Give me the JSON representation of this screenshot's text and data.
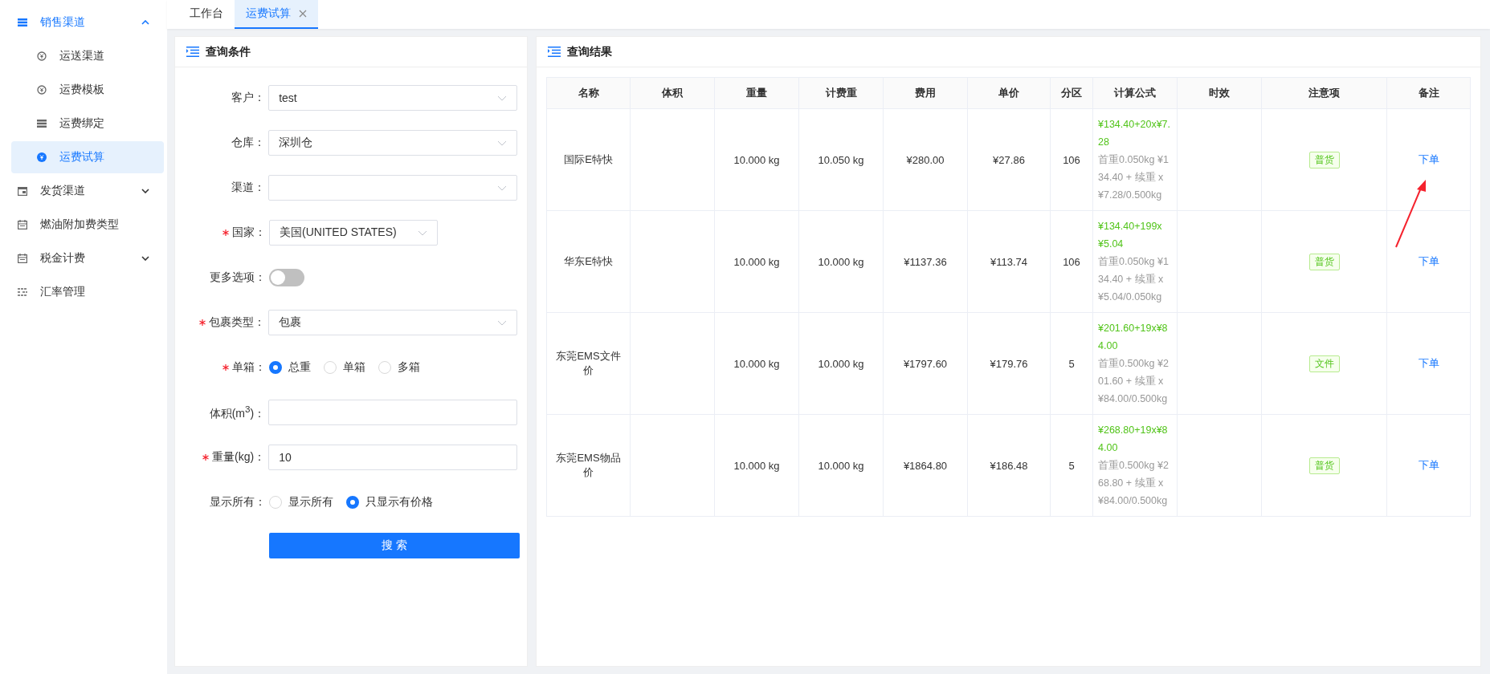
{
  "sidebar": {
    "items": [
      {
        "label": "销售渠道",
        "expanded": true,
        "children": [
          {
            "label": "运送渠道",
            "selected": false
          },
          {
            "label": "运费模板",
            "selected": false
          },
          {
            "label": "运费绑定",
            "selected": false
          },
          {
            "label": "运费试算",
            "selected": true
          }
        ]
      },
      {
        "label": "发货渠道",
        "expanded": false
      },
      {
        "label": "燃油附加费类型"
      },
      {
        "label": "税金计费",
        "expanded": false
      },
      {
        "label": "汇率管理"
      }
    ]
  },
  "tabs": [
    {
      "label": "工作台",
      "selected": false,
      "closable": false
    },
    {
      "label": "运费试算",
      "selected": true,
      "closable": true
    }
  ],
  "query_panel": {
    "title": "查询条件",
    "fields": [
      {
        "kind": "select",
        "label": "客户：",
        "required": false,
        "value": "test"
      },
      {
        "kind": "select",
        "label": "仓库：",
        "required": false,
        "value": "深圳仓"
      },
      {
        "kind": "select",
        "label": "渠道：",
        "required": false
      },
      {
        "kind": "select",
        "label": "国家：",
        "required": true,
        "value": "美国(UNITED STATES)",
        "narrow": true
      },
      {
        "kind": "switch",
        "label": "更多选项：",
        "required": false,
        "on": false
      },
      {
        "kind": "select",
        "label": "包裹类型：",
        "required": true,
        "value": "包裹"
      },
      {
        "kind": "radio",
        "label": "单箱：",
        "required": true,
        "options": [
          {
            "label": "总重",
            "selected": true
          },
          {
            "label": "单箱",
            "selected": false
          },
          {
            "label": "多箱",
            "selected": false
          }
        ]
      },
      {
        "kind": "input",
        "label": "体积(m$^{3}$)：",
        "required": false
      },
      {
        "kind": "input",
        "label": "重量(kg)：",
        "required": true,
        "value": "10"
      },
      {
        "kind": "radio",
        "label": "显示所有：",
        "required": false,
        "options": [
          {
            "label": "显示所有",
            "selected": false
          },
          {
            "label": "只显示有价格",
            "selected": true
          }
        ]
      }
    ],
    "search_button": "搜 索"
  },
  "result_panel": {
    "title": "查询结果",
    "table": {
      "columns": [
        "名称",
        "体积",
        "重量",
        "计费重",
        "费用",
        "单价",
        "分区",
        "计算公式",
        "时效",
        "注意项",
        "备注"
      ],
      "rows": [
        {
          "name": "国际E特快",
          "weight": "10.000 kg",
          "charged_weight": "10.050 kg",
          "fee": "¥280.00",
          "unit_price": "¥27.86",
          "zone": "106",
          "formula": "¥134.40+20x¥7.28",
          "formula_detail": "首重0.050kg ¥134.40 + 续重 x ¥7.28/0.500kg",
          "tag": "普货",
          "action": "下单"
        },
        {
          "name": "华东E特快",
          "weight": "10.000 kg",
          "charged_weight": "10.000 kg",
          "fee": "¥1137.36",
          "unit_price": "¥113.74",
          "zone": "106",
          "formula": "¥134.40+199x¥5.04",
          "formula_detail": "首重0.050kg ¥134.40 + 续重 x ¥5.04/0.050kg",
          "tag": "普货",
          "action": "下单"
        },
        {
          "name": "东莞EMS文件价",
          "weight": "10.000 kg",
          "charged_weight": "10.000 kg",
          "fee": "¥1797.60",
          "unit_price": "¥179.76",
          "zone": "5",
          "formula": "¥201.60+19x¥84.00",
          "formula_detail": "首重0.500kg ¥201.60 + 续重 x ¥84.00/0.500kg",
          "tag": "文件",
          "action": "下单"
        },
        {
          "name": "东莞EMS物品价",
          "weight": "10.000 kg",
          "charged_weight": "10.000 kg",
          "fee": "¥1864.80",
          "unit_price": "¥186.48",
          "zone": "5",
          "formula": "¥268.80+19x¥84.00",
          "formula_detail": "首重0.500kg ¥268.80 + 续重 x ¥84.00/0.500kg",
          "tag": "普货",
          "action": "下单"
        }
      ]
    }
  }
}
